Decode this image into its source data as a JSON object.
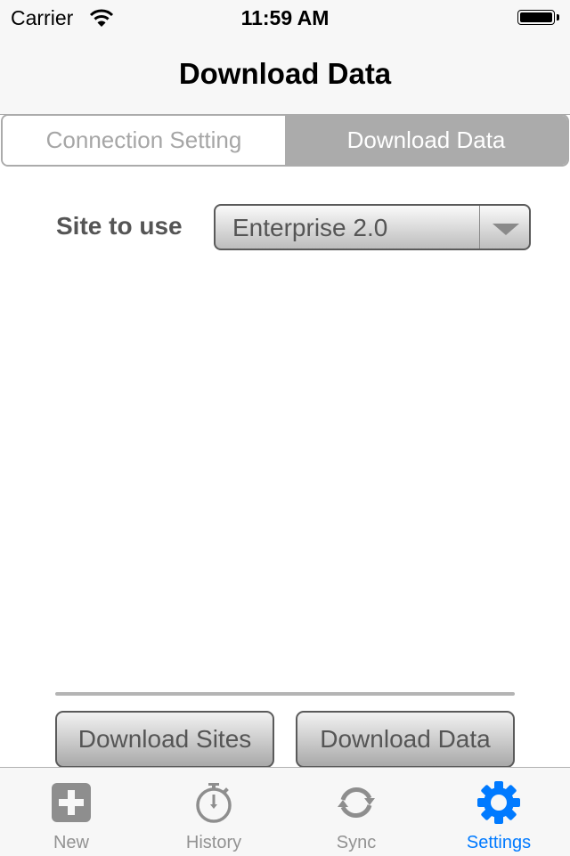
{
  "status_bar": {
    "carrier": "Carrier",
    "time": "11:59 AM",
    "battery_level": 1.0
  },
  "nav": {
    "title": "Download Data"
  },
  "segmented_control": {
    "segments": [
      {
        "label": "Connection Setting",
        "selected": false
      },
      {
        "label": "Download Data",
        "selected": true
      }
    ]
  },
  "form": {
    "site_label": "Site to use",
    "site_selected": "Enterprise 2.0"
  },
  "progress": {
    "value": 0
  },
  "buttons": {
    "download_sites": "Download Sites",
    "download_data": "Download Data"
  },
  "tab_bar": {
    "items": [
      {
        "label": "New",
        "icon": "plus-square-icon",
        "active": false
      },
      {
        "label": "History",
        "icon": "stopwatch-icon",
        "active": false
      },
      {
        "label": "Sync",
        "icon": "sync-icon",
        "active": false
      },
      {
        "label": "Settings",
        "icon": "gear-icon",
        "active": true
      }
    ],
    "active_color": "#007aff",
    "inactive_color": "#929292"
  }
}
